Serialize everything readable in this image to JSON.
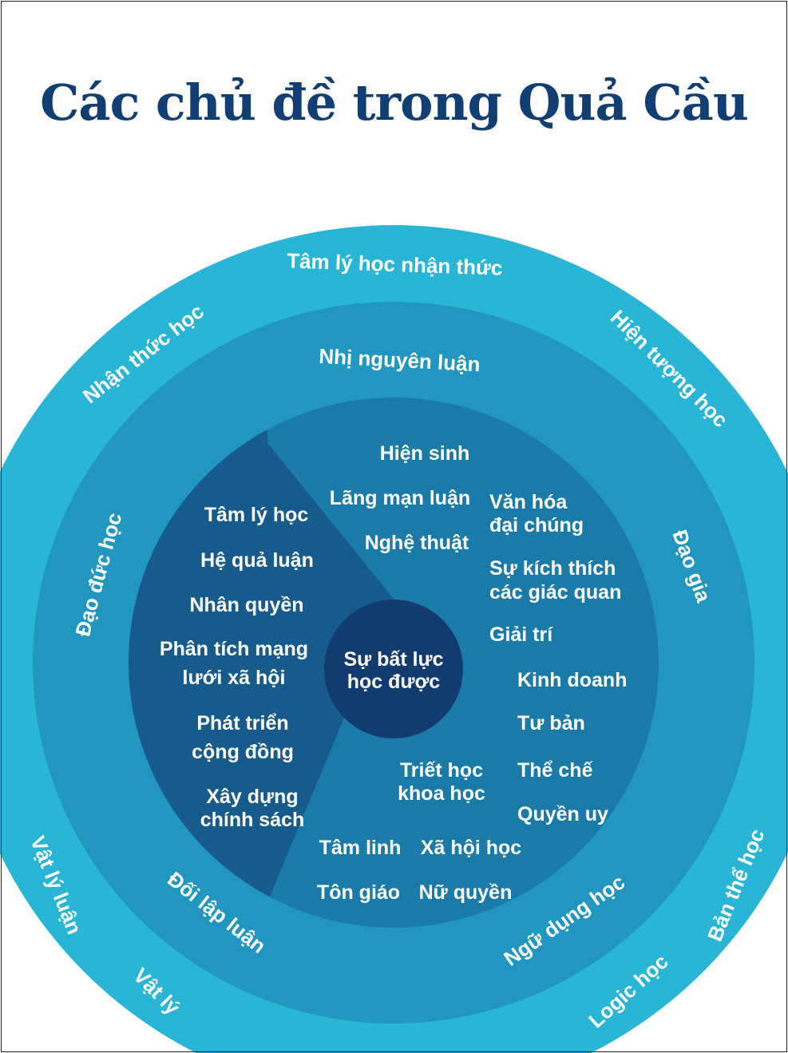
{
  "title": "Các chủ đề trong Quả Cầu",
  "colors": {
    "title": "#123f73",
    "outer_ring": "#29b5d6",
    "middle_ring": "#2096c0",
    "inner_ring_right": "#1a7aa8",
    "inner_ring_left": "#175a8c",
    "core": "#123b70",
    "text": "#ffffff"
  },
  "outer_ring": {
    "labels": [
      "Tâm lý học nhận thức",
      "Hiện tượng học",
      "Nhận thức học",
      "Vật lý luận",
      "Vật lý",
      "Logic học",
      "Bản thể học"
    ]
  },
  "middle_ring": {
    "labels": [
      "Nhị nguyên luận",
      "Đạo đức học",
      "Đạo gia",
      "Đối lập luận",
      "Ngữ dụng học"
    ]
  },
  "inner_left": {
    "items": [
      "Tâm lý học",
      "Hệ quả luận",
      "Nhân quyền",
      "Phân tích mạng",
      "lưới xã hội",
      "Phát triển",
      "cộng đồng",
      "Xây dựng",
      "chính sách"
    ]
  },
  "inner_right": {
    "items": [
      "Hiện sinh",
      "Lãng mạn luận",
      "Nghệ thuật",
      "Văn hóa",
      "đại chúng",
      "Sự kích thích",
      "các giác quan",
      "Giải trí",
      "Kinh doanh",
      "Tư bản",
      "Thể chế",
      "Quyền uy",
      "Triết học",
      "khoa học",
      "Tâm linh",
      "Xã hội học",
      "Tôn giáo",
      "Nữ quyền"
    ]
  },
  "core": {
    "lines": [
      "Sự bất lực",
      "học được"
    ]
  }
}
